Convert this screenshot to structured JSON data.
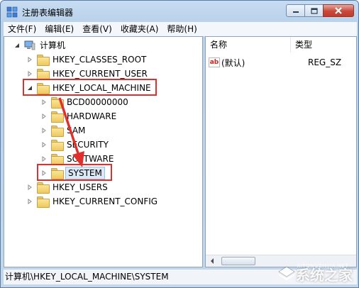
{
  "window": {
    "title": "注册表编辑器"
  },
  "menu": [
    "文件(F)",
    "编辑(E)",
    "查看(V)",
    "收藏夹(A)",
    "帮助(H)"
  ],
  "tree": {
    "root": "计算机",
    "hives": {
      "classes_root": "HKEY_CLASSES_ROOT",
      "current_user": "HKEY_CURRENT_USER",
      "local_machine": "HKEY_LOCAL_MACHINE",
      "users": "HKEY_USERS",
      "current_config": "HKEY_CURRENT_CONFIG"
    },
    "local_machine_children": [
      "BCD00000000",
      "HARDWARE",
      "SAM",
      "SECURITY",
      "SOFTWARE",
      "SYSTEM"
    ]
  },
  "list": {
    "col_name": "名称",
    "col_type": "类型",
    "rows": [
      {
        "icon": "ab",
        "name": "(默认)",
        "type": "REG_SZ"
      }
    ]
  },
  "status": {
    "path": "计算机\\HKEY_LOCAL_MACHINE\\SYSTEM"
  },
  "watermark": {
    "text": "系统之家",
    "sub": "XITONGZHIJIA.NET"
  },
  "colors": {
    "highlight_box": "#e0302c",
    "arrow": "#e0302c",
    "selection": "#dbe8f6"
  }
}
